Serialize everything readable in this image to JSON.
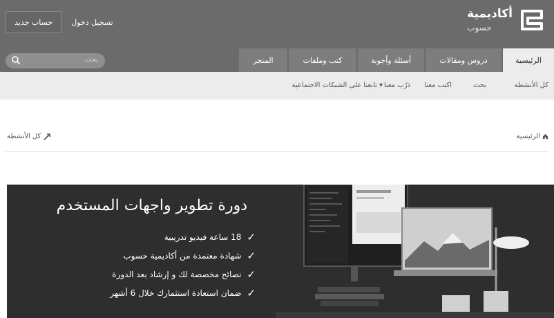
{
  "header": {
    "logo_title": "أكاديمية",
    "logo_subtitle": "حسوب",
    "register_label": "حساب جديد",
    "login_label": "تسجيل دخول"
  },
  "nav": {
    "tabs": [
      {
        "label": "الرئيسية",
        "active": true
      },
      {
        "label": "دروس ومقالات",
        "active": false
      },
      {
        "label": "أسئلة وأجوبة",
        "active": false
      },
      {
        "label": "كتب وملفات",
        "active": false
      },
      {
        "label": "المتجر",
        "active": false
      }
    ],
    "search_placeholder": "بحث"
  },
  "subnav": {
    "items": [
      "كل الأنشطة",
      "بحث",
      "اكتب معنا",
      "ذرّب معنا",
      "تابعنا على الشبكات الاجتماعية ▾"
    ]
  },
  "breadcrumb": {
    "home": "الرئيسية",
    "all_activity": "كل الأنشطة"
  },
  "banner": {
    "title": "دورة تطوير واجهات المستخدم",
    "bullets": [
      "18 ساعة فيديو تدريبية",
      "شهادة معتمدة من أكاديمية حسوب",
      "نصائح مخصصة لك و إرشاد بعد الدورة",
      "ضمان استعادة استثمارك خلال 6 أشهر"
    ]
  },
  "colors": {
    "header_bg": "#6b6b6b",
    "tab_bg": "#7d7d7d",
    "active_tab_bg": "#ececec",
    "banner_bg": "#2e2e2e"
  }
}
